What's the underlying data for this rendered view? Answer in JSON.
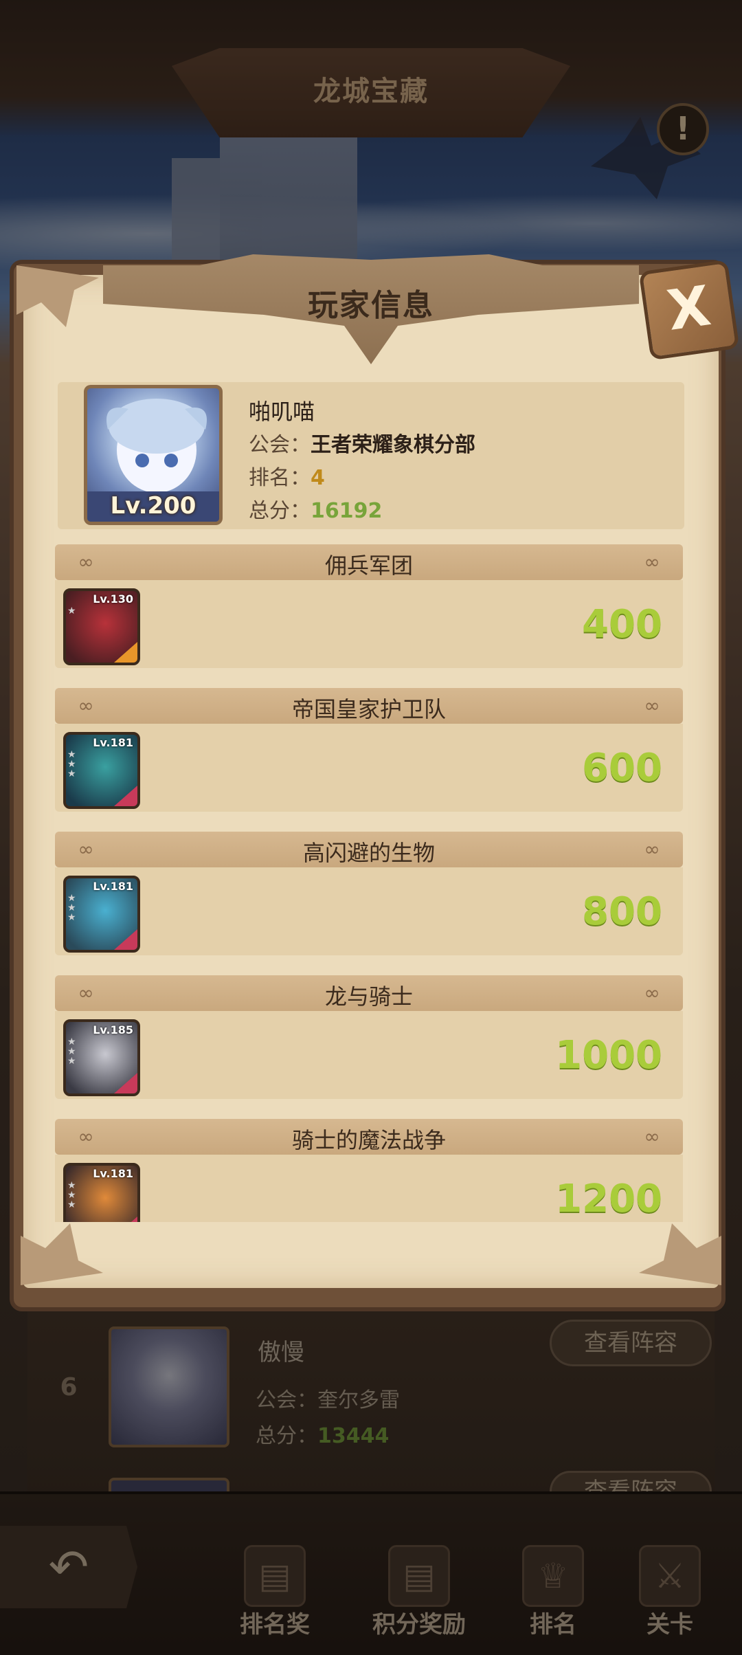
{
  "screen_title": "龙城宝藏",
  "info_button_label": "!",
  "modal": {
    "title": "玩家信息",
    "close_label": "X",
    "player": {
      "name": "啪叽喵",
      "level": "Lv.200",
      "guild_label": "公会：",
      "guild": "王者荣耀象棋分部",
      "rank_label": "排名：",
      "rank": "4",
      "score_label": "总分：",
      "score": "16192"
    },
    "teams": [
      {
        "name": "佣兵军团",
        "hero_level": "Lv.130",
        "score": "400",
        "colors": [
          "#b8323a",
          "#4a1e22"
        ],
        "stripe": "#e8962a"
      },
      {
        "name": "帝国皇家护卫队",
        "hero_level": "Lv.181",
        "score": "600",
        "colors": [
          "#3aa0a0",
          "#1a3a4a"
        ],
        "stripe": "#c83a5a"
      },
      {
        "name": "高闪避的生物",
        "hero_level": "Lv.181",
        "score": "800",
        "colors": [
          "#4ab0d0",
          "#2a4a5a"
        ],
        "stripe": "#c83a5a"
      },
      {
        "name": "龙与骑士",
        "hero_level": "Lv.185",
        "score": "1000",
        "colors": [
          "#c8c8d0",
          "#3a3a44"
        ],
        "stripe": "#c83a5a"
      },
      {
        "name": "骑士的魔法战争",
        "hero_level": "Lv.181",
        "score": "1200",
        "colors": [
          "#e08a3a",
          "#3a2a2a"
        ],
        "stripe": "#c83a5a"
      }
    ]
  },
  "ranking_list": {
    "rank": "6",
    "name": "傲慢",
    "guild_label": "公会：",
    "guild": "奎尔多雷",
    "score_label": "总分：",
    "score": "13444",
    "view_lineup": "查看阵容",
    "view_lineup_2": "查看阵容"
  },
  "bottom_nav": {
    "back_icon": "back-arrow-icon",
    "items": [
      {
        "label": "排名奖",
        "icon": "scroll-icon"
      },
      {
        "label": "积分奖励",
        "icon": "scroll-icon"
      },
      {
        "label": "排名",
        "icon": "trophy-icon"
      },
      {
        "label": "关卡",
        "icon": "crossed-swords-icon"
      }
    ]
  },
  "colors": {
    "score_green": "#a9cc3a",
    "rank_gold": "#c08a1a",
    "parchment": "#ecdcbc"
  }
}
